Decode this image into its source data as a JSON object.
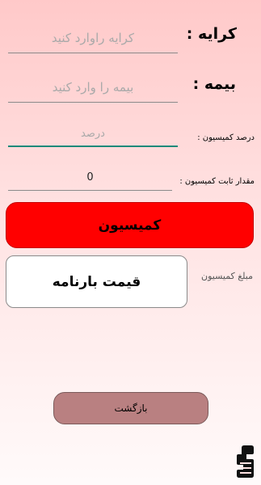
{
  "form": {
    "rent": {
      "label": "کرایه :",
      "placeholder": "کرایه راوارد کنید"
    },
    "insurance": {
      "label": "بیمه :",
      "placeholder": "بیمه را وارد کنید"
    },
    "commission_percent": {
      "label": "درصد کمیسیون :",
      "placeholder": "درصد"
    },
    "commission_fixed": {
      "label": "مقدار ثابت کمیسیون :",
      "value": "0"
    }
  },
  "buttons": {
    "commission": "کمیسیون",
    "back": "بازگشت"
  },
  "result": {
    "label": "مبلغ کمیسیون",
    "value": "قیمت بارنامه"
  },
  "colors": {
    "commission_button": "#ff0000",
    "back_button": "#b98081",
    "focused_underline": "#1a8a7a"
  },
  "logo": {
    "icon": "app-logo-icon"
  }
}
